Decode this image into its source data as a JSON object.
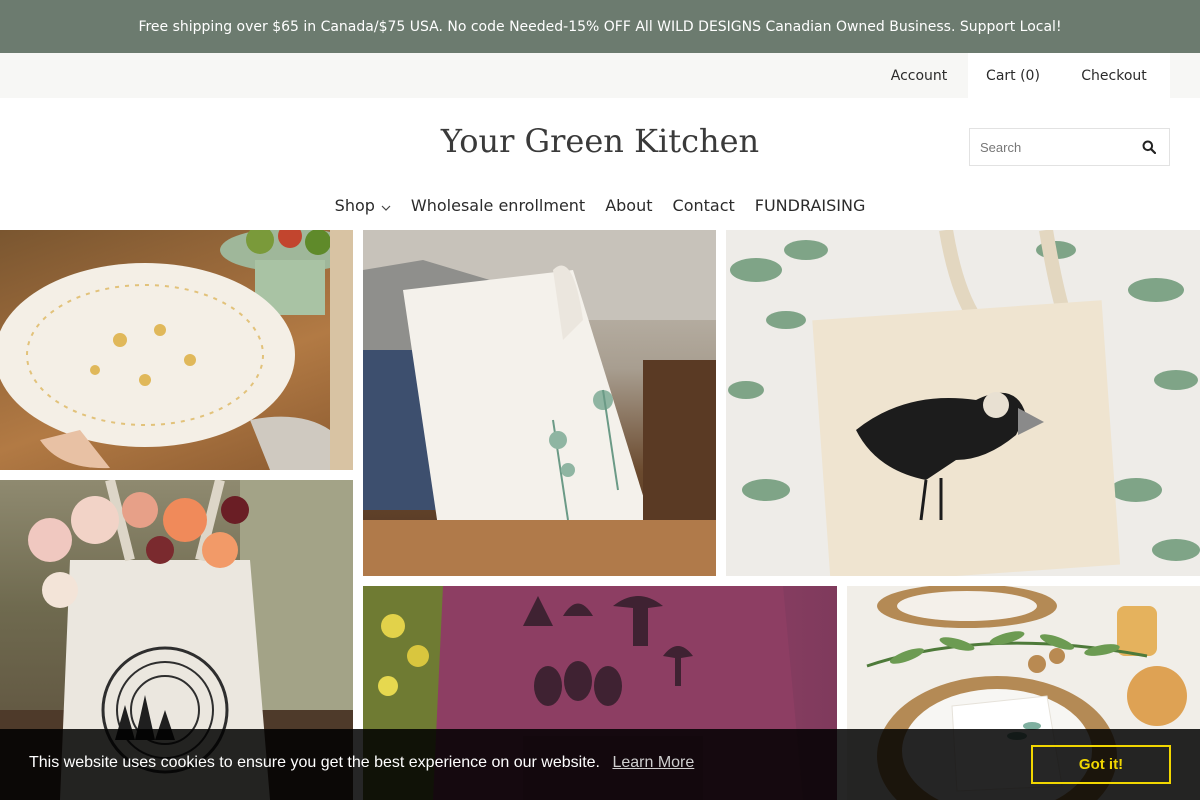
{
  "announcement": "Free shipping over $65 in Canada/$75 USA. No code Needed-15% OFF All WILD DESIGNS Canadian Owned Business. Support Local!",
  "topbar": {
    "account": "Account",
    "cart": "Cart (0)",
    "checkout": "Checkout"
  },
  "brand": "Your Green Kitchen",
  "search": {
    "placeholder": "Search",
    "icon": "search-icon"
  },
  "nav": {
    "shop": "Shop",
    "wholesale": "Wholesale enrollment",
    "about": "About",
    "contact": "Contact",
    "fundraising": "FUNDRAISING"
  },
  "cookie": {
    "message": "This website uses cookies to ensure you get the best experience on our website.",
    "learn_more": "Learn More",
    "accept": "Got it!"
  },
  "colors": {
    "announcement_bg": "#6c7b6f",
    "topbar_bg": "#f7f7f5",
    "cookie_button": "#f1d600"
  }
}
